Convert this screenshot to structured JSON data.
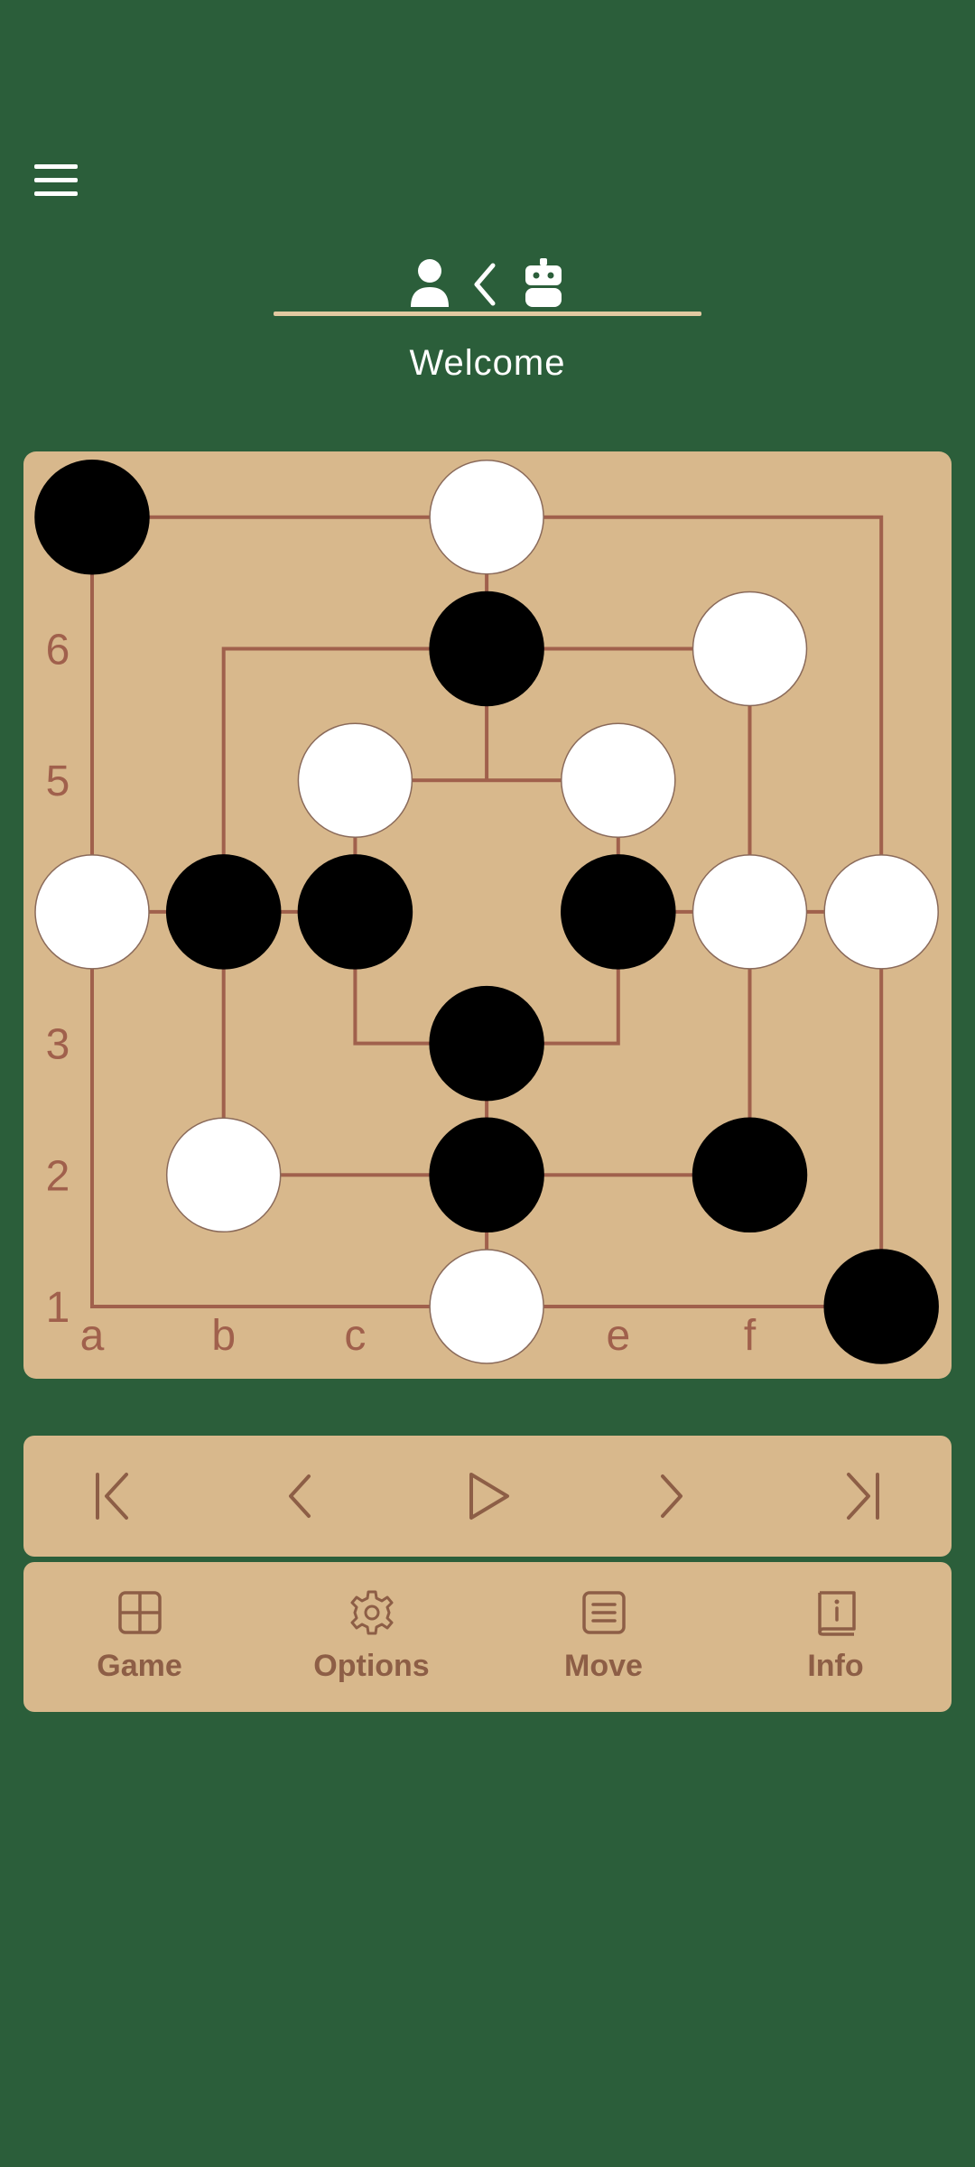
{
  "header": {
    "menu_icon": "hamburger-menu-icon",
    "player_icon": "person-icon",
    "turn_icon": "chevron-left-icon",
    "opponent_icon": "robot-icon",
    "status": "Welcome"
  },
  "board": {
    "ranks": [
      "1",
      "2",
      "3",
      "5",
      "6"
    ],
    "files": [
      "a",
      "b",
      "c",
      "e",
      "f"
    ],
    "pieces": {
      "a7": "black",
      "d7": "white",
      "d6": "black",
      "f6": "white",
      "c5": "white",
      "e5": "white",
      "a4": "white",
      "b4": "black",
      "c4": "black",
      "e4": "black",
      "f4": "white",
      "g4": "white",
      "d3": "black",
      "b2": "white",
      "d2": "black",
      "f2": "black",
      "d1": "white",
      "g1": "black"
    },
    "colors": {
      "board": "#d8b88c",
      "line": "#a0604c",
      "white_piece": "#ffffff",
      "black_piece": "#000000"
    }
  },
  "navigation": {
    "first_icon": "skip-to-first-icon",
    "back_icon": "step-back-icon",
    "play_icon": "play-icon",
    "forward_icon": "step-forward-icon",
    "last_icon": "skip-to-last-icon"
  },
  "tabs": [
    {
      "label": "Game",
      "icon": "grid-icon"
    },
    {
      "label": "Options",
      "icon": "gear-icon"
    },
    {
      "label": "Move",
      "icon": "list-icon"
    },
    {
      "label": "Info",
      "icon": "book-info-icon"
    }
  ],
  "colors": {
    "background": "#2b5e3a",
    "panel": "#d8b88c",
    "accent": "#8d5e46"
  }
}
